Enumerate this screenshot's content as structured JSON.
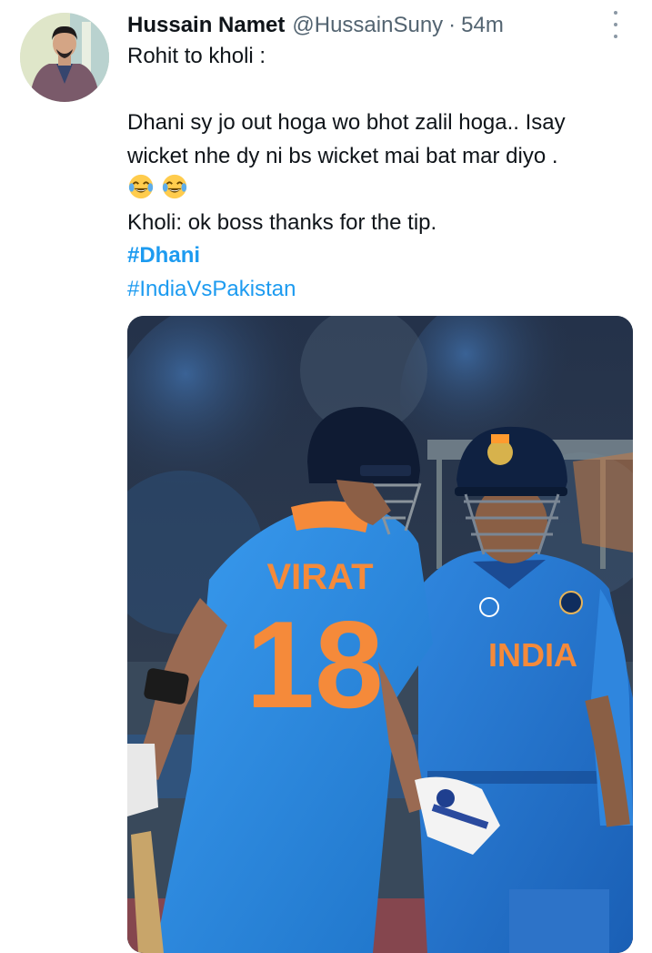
{
  "tweet": {
    "author_name": "Hussain Namet",
    "author_handle": "@HussainSuny",
    "separator": "·",
    "time": "54m",
    "lines": {
      "l1": "Rohit to kholi :",
      "l3": "Dhani sy jo out hoga wo bhot zalil hoga.. Isay",
      "l4": "wicket nhe dy ni bs wicket mai bat mar diyo .",
      "l6": "Kholi: ok boss thanks for the tip."
    },
    "emojis": [
      "face-with-tears-of-joy-icon",
      "face-with-tears-of-joy-icon"
    ],
    "hashtags": [
      "#Dhani",
      "#IndiaVsPakistan"
    ],
    "media": {
      "jersey_left_name": "VIRAT",
      "jersey_left_number": "18",
      "jersey_right_text": "INDIA"
    }
  },
  "colors": {
    "link": "#1d9bf0",
    "text": "#0f1419",
    "muted": "#536471",
    "jersey_blue": "#2b8ee0",
    "jersey_orange": "#f58a3a"
  }
}
